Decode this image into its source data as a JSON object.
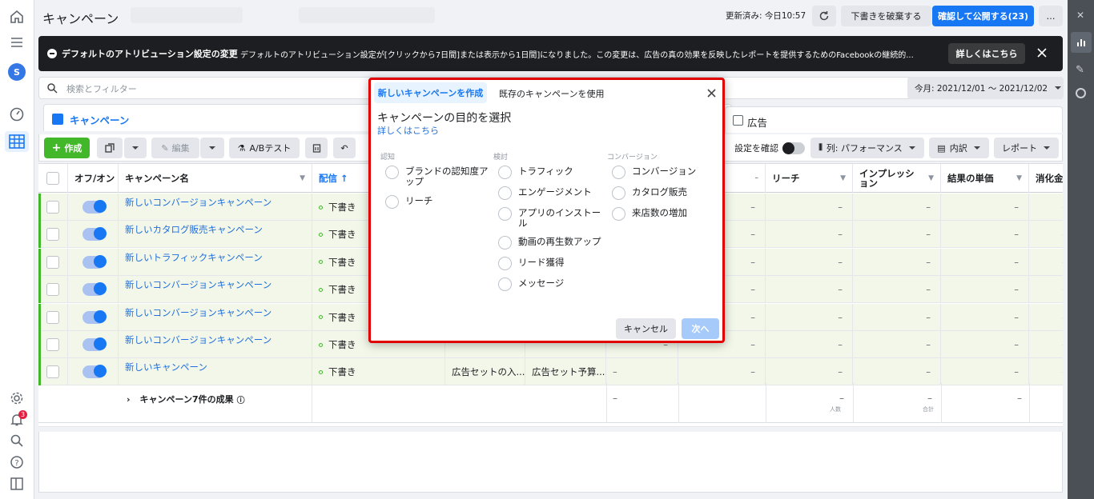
{
  "page": {
    "title": "キャンペーン"
  },
  "topbar": {
    "updated": "更新済み: 今日10:57",
    "discard": "下書きを破棄する",
    "publish": "確認して公開する(23)",
    "more": "…"
  },
  "banner": {
    "title": "デフォルトのアトリビューション設定の変更",
    "text": "デフォルトのアトリビューション設定が[クリックから7日間]または表示から1日間]になりました。この変更は、広告の真の効果を反映したレポートを提供するためのFacebookの継続的...",
    "button": "詳しくはこちら"
  },
  "search": {
    "placeholder": "検索とフィルター",
    "date_range": "今月: 2021/12/01 ～ 2021/12/02"
  },
  "tabs": {
    "campaign": "キャンペーン",
    "ads": "広告"
  },
  "toolbar": {
    "create": "作成",
    "edit": "編集",
    "ab_test": "A/Bテスト",
    "review_settings": "設定を確認",
    "columns": "列: パフォーマンス",
    "breakdown": "内訳",
    "reports": "レポート"
  },
  "table": {
    "headers": {
      "onoff": "オフ/オン",
      "name": "キャンペーン名",
      "delivery": "配信 ↑",
      "reach": "リーチ",
      "impressions": "インプレッション",
      "cost_per_result": "結果の単価",
      "spend": "消化金"
    },
    "rows": [
      {
        "name": "新しいコンバージョンキャンペーン",
        "delivery": "下書き"
      },
      {
        "name": "新しいカタログ販売キャンペーン",
        "delivery": "下書き"
      },
      {
        "name": "新しいトラフィックキャンペーン",
        "delivery": "下書き"
      },
      {
        "name": "新しいコンバージョンキャンペーン",
        "delivery": "下書き"
      },
      {
        "name": "新しいコンバージョンキャンペーン",
        "delivery": "下書き"
      },
      {
        "name": "新しいコンバージョンキャンペーン",
        "delivery": "下書き"
      },
      {
        "name": "新しいキャンペーン",
        "delivery": "下書き",
        "bid": "広告セットの入...",
        "budget": "広告セット予算..."
      }
    ],
    "dash": "–",
    "summary": {
      "label": "キャンペーン7件の成果",
      "reach_note": "人数",
      "impressions_note": "合計"
    }
  },
  "notifications": {
    "badge": "3"
  },
  "modal": {
    "tab_new": "新しいキャンペーンを作成",
    "tab_existing": "既存のキャンペーンを使用",
    "title": "キャンペーンの目的を選択",
    "learn_more": "詳しくはこちら",
    "columns": [
      {
        "label": "認知",
        "options": [
          "ブランドの認知度アップ",
          "リーチ"
        ]
      },
      {
        "label": "検討",
        "options": [
          "トラフィック",
          "エンゲージメント",
          "アプリのインストール",
          "動画の再生数アップ",
          "リード獲得",
          "メッセージ"
        ]
      },
      {
        "label": "コンバージョン",
        "options": [
          "コンバージョン",
          "カタログ販売",
          "来店数の増加"
        ]
      }
    ],
    "cancel": "キャンセル",
    "next": "次へ"
  },
  "colors": {
    "accent": "#1877f2",
    "link": "#216fdb",
    "draft": "#42b72a",
    "banner": "#1c1e21",
    "highlight": "#e00000"
  }
}
